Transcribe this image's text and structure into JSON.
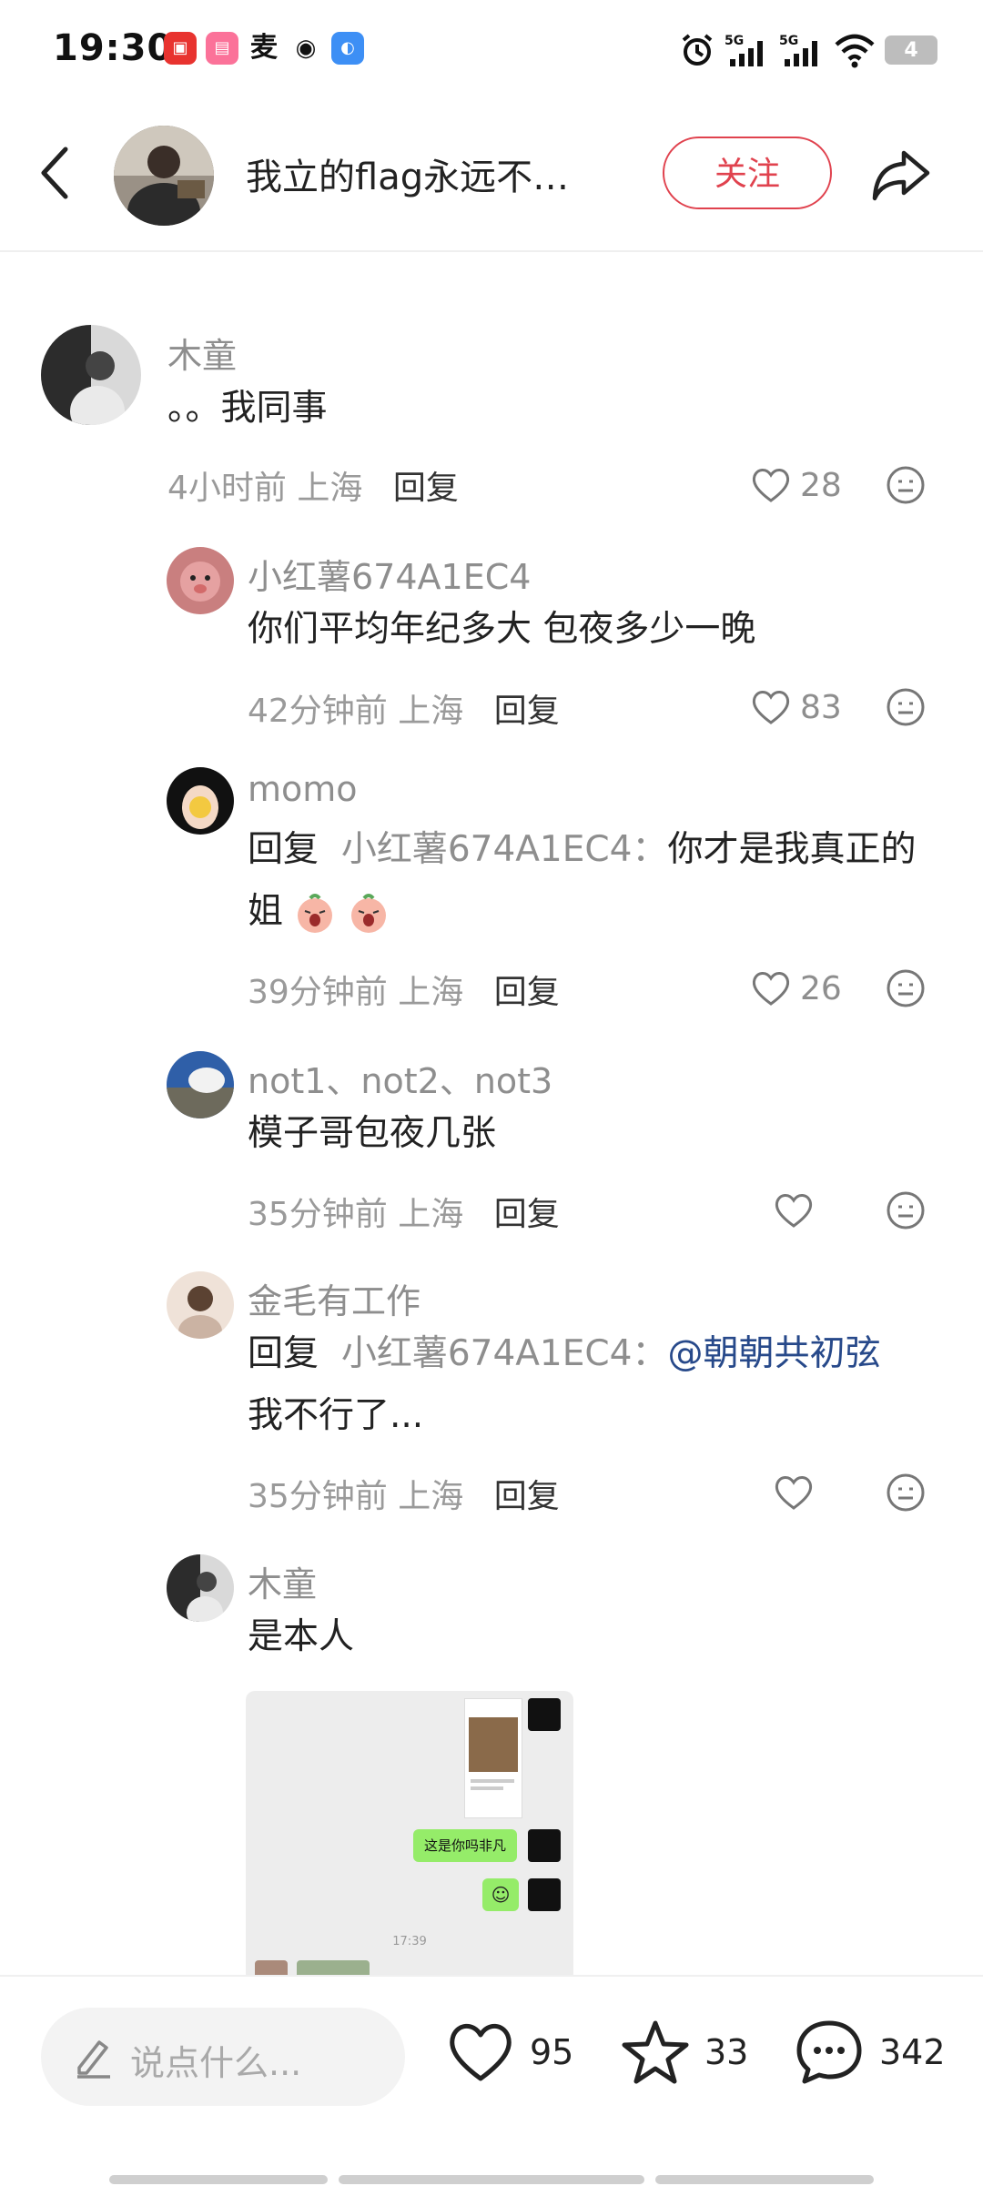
{
  "status_bar": {
    "time": "19:30",
    "apps": [
      "app-1",
      "app-2",
      "app-3",
      "weibo",
      "app-5"
    ],
    "network": "5G",
    "battery": "4"
  },
  "header": {
    "title": "我立的flag永远不…",
    "follow_label": "关注"
  },
  "comments": [
    {
      "user": "木童",
      "text": "。。我同事",
      "time": "4小时前",
      "location": "上海",
      "reply_label": "回复",
      "likes": "28"
    },
    {
      "user": "小红薯674A1EC4",
      "text": "你们平均年纪多大 包夜多少一晚",
      "time": "42分钟前",
      "location": "上海",
      "reply_label": "回复",
      "likes": "83"
    },
    {
      "user": "momo",
      "reply_prefix": "回复",
      "reply_target": "小红薯674A1EC4：",
      "text_line1": "你才是我真正的",
      "text_line2": "姐",
      "time": "39分钟前",
      "location": "上海",
      "reply_label": "回复",
      "likes": "26"
    },
    {
      "user": "not1、not2、not3",
      "text": "模子哥包夜几张",
      "time": "35分钟前",
      "location": "上海",
      "reply_label": "回复",
      "likes": ""
    },
    {
      "user": "金毛有工作",
      "reply_prefix": "回复",
      "reply_target": "小红薯674A1EC4：",
      "mention": "@朝朝共初弦",
      "text_line2": "我不行了...",
      "time": "35分钟前",
      "location": "上海",
      "reply_label": "回复",
      "likes": ""
    },
    {
      "user": "木童",
      "text": "是本人",
      "image": {
        "bubble1": "这是你吗非凡",
        "time": "17:39"
      }
    }
  ],
  "bottom_bar": {
    "input_placeholder": "说点什么...",
    "likes": "95",
    "stars": "33",
    "comments": "342"
  },
  "colors": {
    "accent_red": "#e0424e",
    "mention_blue": "#27498a",
    "meta_gray": "#9a9a9a",
    "chat_green": "#95ec69"
  }
}
